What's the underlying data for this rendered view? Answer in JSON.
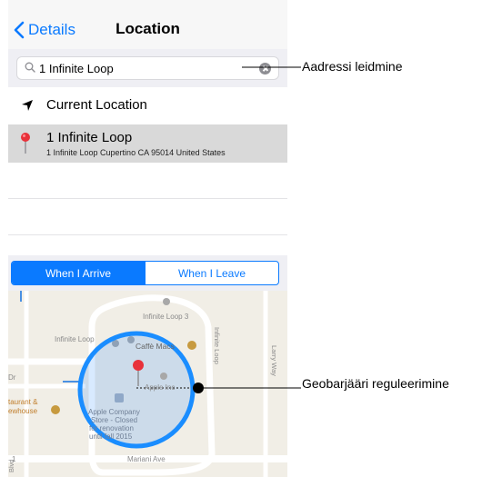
{
  "navbar": {
    "back_label": "Details",
    "title": "Location"
  },
  "search": {
    "value": "1 Infinite Loop"
  },
  "current_location": {
    "label": "Current Location"
  },
  "result": {
    "title": "1 Infinite Loop",
    "subtitle": "1 Infinite Loop Cupertino CA 95014 United States"
  },
  "segment": {
    "arrive": "When I Arrive",
    "leave": "When I Leave",
    "selected": "arrive"
  },
  "map": {
    "labels": {
      "infinite_loop_3": "Infinite Loop 3",
      "infinite_loop_a": "Infinite Loop",
      "caffe_macs": "Caffè Macs",
      "apple_inc": "Apple Inc",
      "infinite_loop_v": "Infinite Loop",
      "larry_way": "Larry Way",
      "dr": "Dr",
      "restaurant_1": "taurant &",
      "restaurant_2": "ewhouse",
      "store_1": "Apple Company",
      "store_2": "Store - Closed",
      "store_3": "for renovation",
      "store_4": "until fall 2015",
      "mariani": "Mariani Ave",
      "blvd": "Blvd",
      "number": "1"
    }
  },
  "callouts": {
    "search": "Aadressi leidmine",
    "geofence": "Geobarjääri reguleerimine"
  },
  "colors": {
    "accent": "#0a7aff",
    "pin": "#e8313a"
  }
}
